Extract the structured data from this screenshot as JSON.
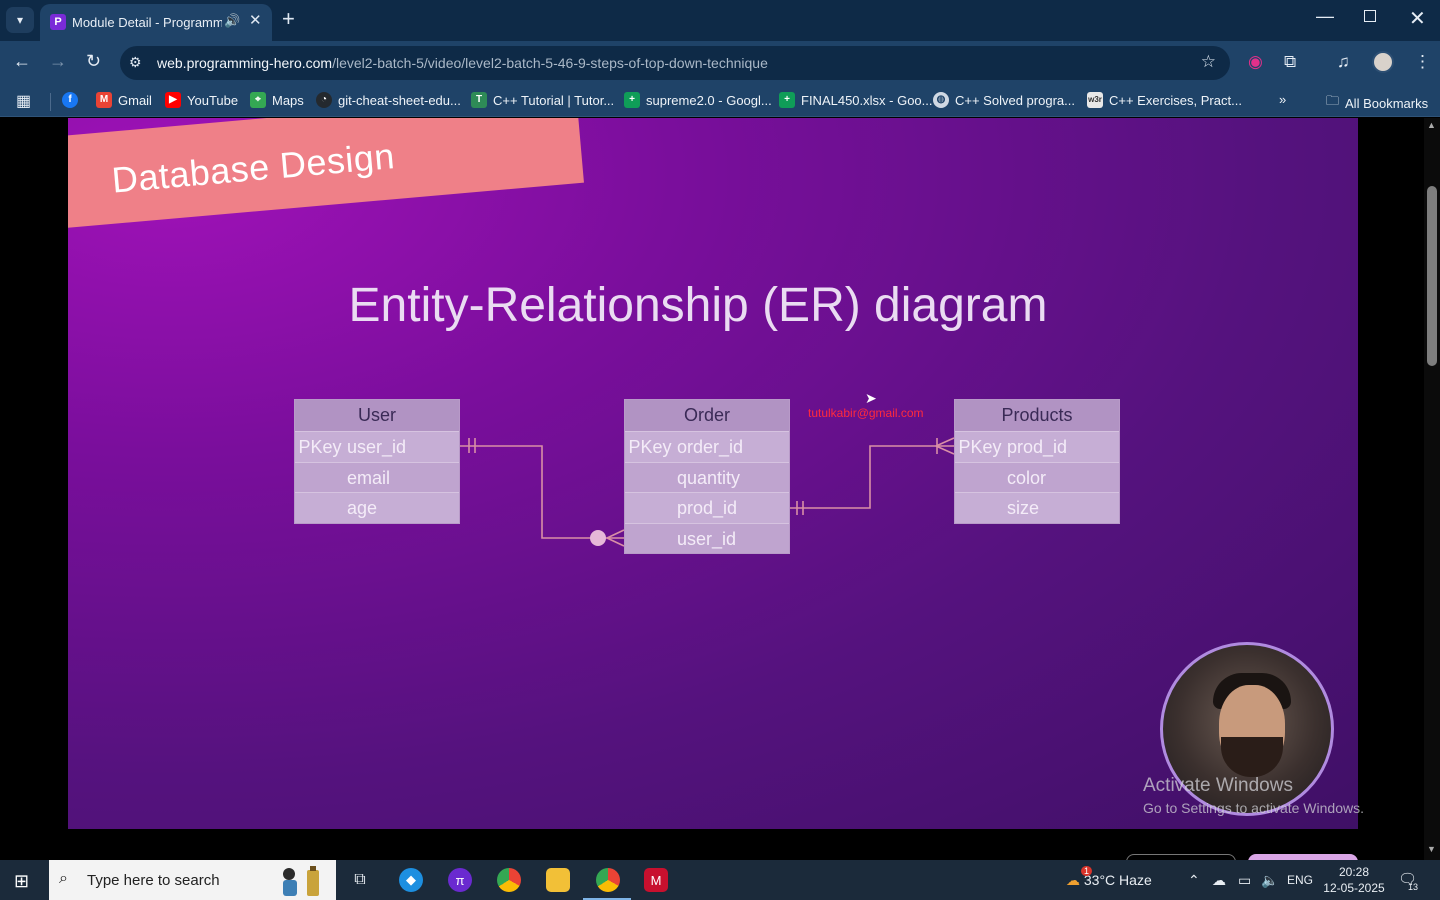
{
  "browser": {
    "tab_title": "Module Detail - Programmi",
    "url_host": "web.programming-hero.com",
    "url_path": "/level2-batch-5/video/level2-batch-5-46-9-steps-of-top-down-technique",
    "bookmarks": [
      {
        "label": "",
        "icon": "facebook-icon",
        "color": "#1877f2"
      },
      {
        "label": "Gmail",
        "icon": "gmail-icon",
        "color": "#ea4335"
      },
      {
        "label": "YouTube",
        "icon": "youtube-icon",
        "color": "#ff0000"
      },
      {
        "label": "Maps",
        "icon": "maps-icon",
        "color": "#34a853"
      },
      {
        "label": "git-cheat-sheet-edu...",
        "icon": "github-icon",
        "color": "#24292e"
      },
      {
        "label": "C++ Tutorial | Tutor...",
        "icon": "tutor-icon",
        "color": "#2e8b57"
      },
      {
        "label": "supreme2.0 - Googl...",
        "icon": "sheets-icon",
        "color": "#0f9d58"
      },
      {
        "label": "FINAL450.xlsx - Goo...",
        "icon": "sheets-icon",
        "color": "#0f9d58"
      },
      {
        "label": "C++ Solved progra...",
        "icon": "globe-icon",
        "color": "#cfd8e3"
      },
      {
        "label": "C++ Exercises, Pract...",
        "icon": "w3r-icon",
        "color": "#e8e8e8"
      }
    ],
    "all_bookmarks": "All Bookmarks"
  },
  "slide": {
    "ribbon": "Database Design",
    "title": "Entity-Relationship (ER) diagram",
    "watermark_email": "tutulkabir@gmail.com",
    "entities": {
      "user": {
        "name": "User",
        "rows": [
          {
            "pk": "PKey",
            "field": "user_id"
          },
          {
            "pk": "",
            "field": "email"
          },
          {
            "pk": "",
            "field": "age"
          }
        ]
      },
      "order": {
        "name": "Order",
        "rows": [
          {
            "pk": "PKey",
            "field": "order_id"
          },
          {
            "pk": "",
            "field": "quantity"
          },
          {
            "pk": "",
            "field": "prod_id"
          },
          {
            "pk": "",
            "field": "user_id"
          }
        ]
      },
      "products": {
        "name": "Products",
        "rows": [
          {
            "pk": "PKey",
            "field": "prod_id"
          },
          {
            "pk": "",
            "field": "color"
          },
          {
            "pk": "",
            "field": "size"
          }
        ]
      }
    },
    "relationship_color": "#d98fa6"
  },
  "overlay": {
    "activate_title": "Activate Windows",
    "activate_sub": "Go to Settings to activate Windows."
  },
  "taskbar": {
    "search_placeholder": "Type here to search",
    "weather": "33°C  Haze",
    "weather_badge": "1",
    "language": "ENG",
    "time": "20:28",
    "date": "12-05-2025",
    "notifications": "13"
  }
}
